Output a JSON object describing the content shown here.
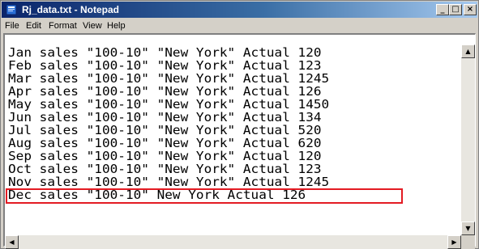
{
  "window": {
    "title": "Rj_data.txt - Notepad",
    "icon": "notepad-icon"
  },
  "title_buttons": {
    "minimize": "_",
    "maximize": "□",
    "close": "×"
  },
  "menu": {
    "file": "File",
    "edit": "Edit",
    "format": "Format",
    "view": "View",
    "help": "Help"
  },
  "editor": {
    "lines": [
      "Jan sales \"100-10\" \"New York\" Actual 120",
      "Feb sales \"100-10\" \"New York\" Actual 123",
      "Mar sales \"100-10\" \"New York\" Actual 1245",
      "Apr sales \"100-10\" \"New York\" Actual 126",
      "May sales \"100-10\" \"New York\" Actual 1450",
      "Jun sales \"100-10\" \"New York\" Actual 134",
      "Jul sales \"100-10\" \"New York\" Actual 520",
      "Aug sales \"100-10\" \"New York\" Actual 620",
      "Sep sales \"100-10\" \"New York\" Actual 120",
      "Oct sales \"100-10\" \"New York\" Actual 123",
      "Nov sales \"100-10\" \"New York\" Actual 1245",
      "Dec sales \"100-10\" New York Actual 126"
    ],
    "highlight_color": "#e31b23"
  },
  "scrollbars": {
    "up": "▲",
    "down": "▼",
    "left": "◀",
    "right": "▶"
  }
}
